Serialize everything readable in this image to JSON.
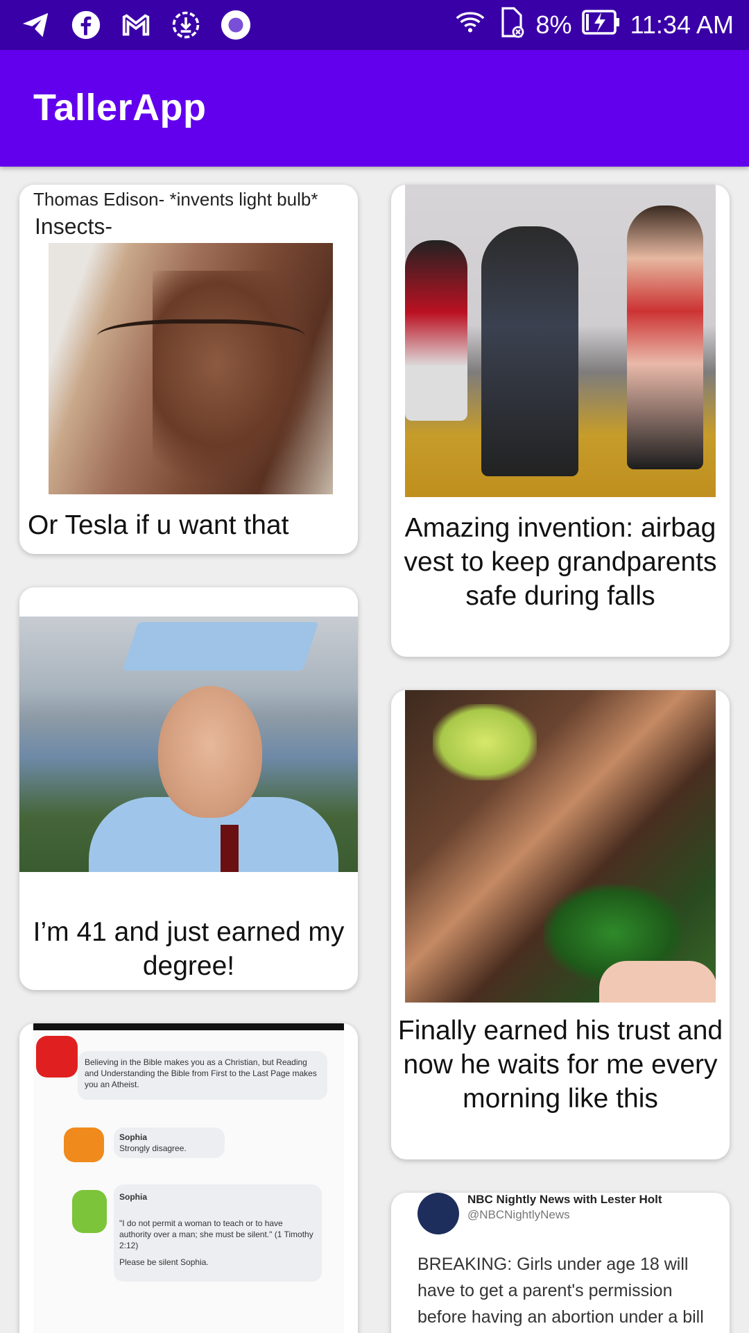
{
  "status_bar": {
    "left_icons": [
      "telegram-icon",
      "facebook-icon",
      "gmail-icon",
      "download-icon",
      "record-icon"
    ],
    "right_icons": [
      "wifi-icon",
      "no-sim-icon",
      "battery-charging-icon"
    ],
    "battery": "8%",
    "time": "11:34 AM"
  },
  "app_bar": {
    "title": "TallerApp"
  },
  "colors": {
    "status_bar": "#3a00a8",
    "app_bar": "#6200ee",
    "background": "#eeeeee",
    "card": "#ffffff"
  },
  "feed": {
    "left_column": [
      {
        "image_text_top": "Thomas Edison- *invents light bulb*",
        "image_text_sub": "Insects-",
        "caption": "Or Tesla if u want that"
      },
      {
        "caption": "I’m 41 and just earned my degree!"
      },
      {
        "image_texts": [
          "Believing in the Bible makes you as a Christian, but Reading and Understanding the Bible from First to the Last Page makes you an Atheist.",
          "Sophia",
          "Strongly disagree.",
          "Sophia",
          "\"I do not permit a woman to teach or to have authority over a man; she must be silent.\" (1 Timothy 2:12)",
          "Please be silent Sophia."
        ]
      }
    ],
    "right_column": [
      {
        "caption": "Amazing invention: airbag vest to keep grandparents safe during falls"
      },
      {
        "caption": "Finally earned his trust and now he waits for me every morning like this"
      },
      {
        "tweet_name": "NBC Nightly News with Lester Holt",
        "tweet_handle": "@NBCNightlyNews",
        "tweet_text": "BREAKING: Girls under age 18 will have to get a parent's permission before having an abortion under a bill"
      }
    ]
  }
}
